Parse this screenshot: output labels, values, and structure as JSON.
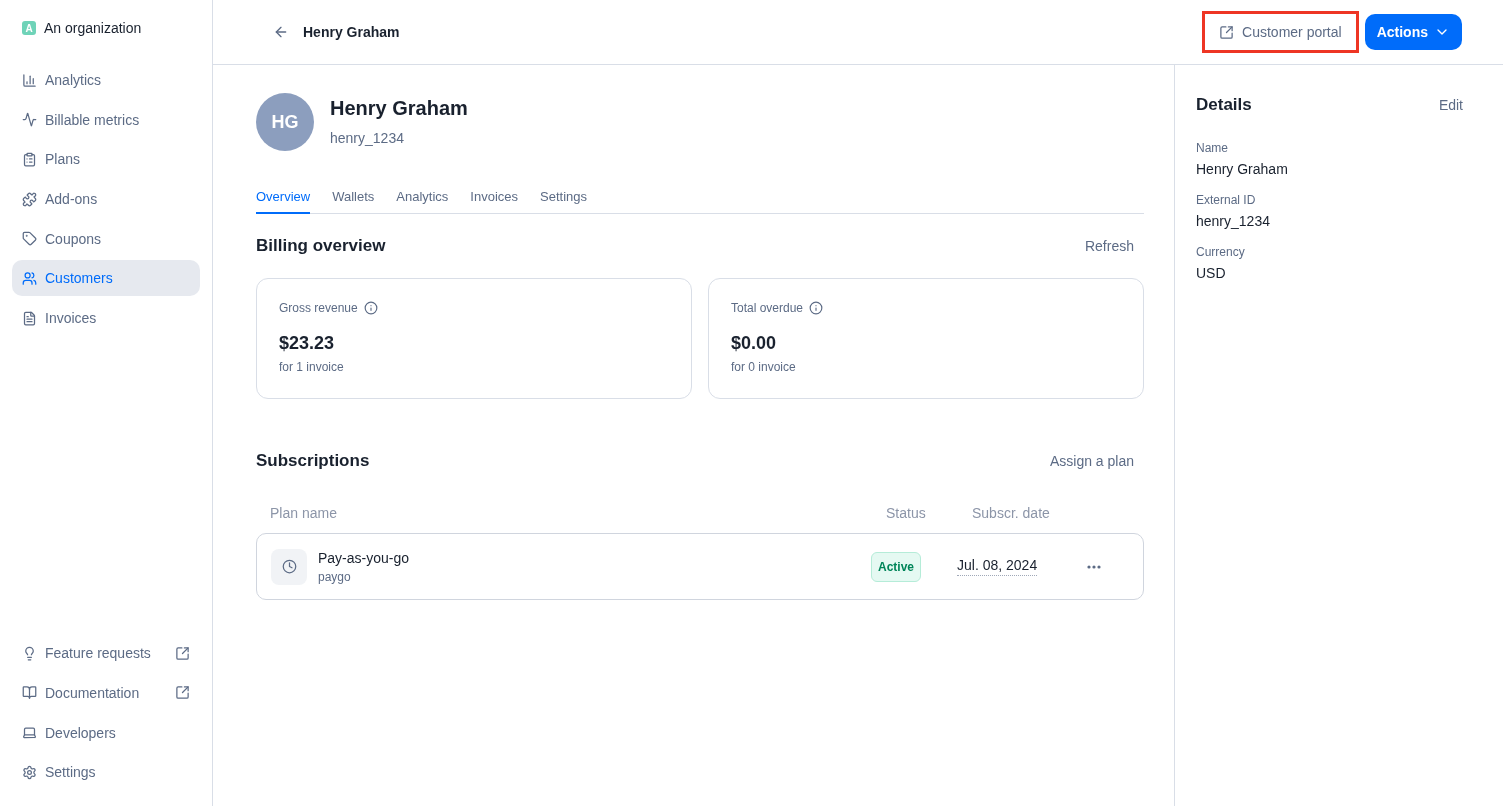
{
  "organization": {
    "initial": "A",
    "name": "An organization"
  },
  "sidebar": {
    "items": [
      {
        "label": "Analytics",
        "selected": false,
        "external": false
      },
      {
        "label": "Billable metrics",
        "selected": false,
        "external": false
      },
      {
        "label": "Plans",
        "selected": false,
        "external": false
      },
      {
        "label": "Add-ons",
        "selected": false,
        "external": false
      },
      {
        "label": "Coupons",
        "selected": false,
        "external": false
      },
      {
        "label": "Customers",
        "selected": true,
        "external": false
      },
      {
        "label": "Invoices",
        "selected": false,
        "external": false
      }
    ],
    "footer_items": [
      {
        "label": "Feature requests",
        "external": true
      },
      {
        "label": "Documentation",
        "external": true
      },
      {
        "label": "Developers",
        "external": false
      },
      {
        "label": "Settings",
        "external": false
      }
    ]
  },
  "header": {
    "title": "Henry Graham",
    "portal_button": {
      "label": "Customer portal",
      "highlighted": true
    },
    "actions_button": "Actions"
  },
  "customer": {
    "initials": "HG",
    "name": "Henry Graham",
    "external_id": "henry_1234"
  },
  "tabs": [
    {
      "label": "Overview",
      "selected": true
    },
    {
      "label": "Wallets",
      "selected": false
    },
    {
      "label": "Analytics",
      "selected": false
    },
    {
      "label": "Invoices",
      "selected": false
    },
    {
      "label": "Settings",
      "selected": false
    }
  ],
  "billing_overview": {
    "title": "Billing overview",
    "action": "Refresh",
    "cards": [
      {
        "label": "Gross revenue",
        "amount": "$23.23",
        "note": "for 1 invoice"
      },
      {
        "label": "Total overdue",
        "amount": "$0.00",
        "note": "for 0 invoice"
      }
    ]
  },
  "subscriptions": {
    "title": "Subscriptions",
    "action": "Assign a plan",
    "columns": [
      "Plan name",
      "Status",
      "Subscr. date"
    ],
    "rows": [
      {
        "name": "Pay-as-you-go",
        "code": "paygo",
        "status": "Active",
        "date": "Jul. 08, 2024"
      }
    ]
  },
  "details": {
    "title": "Details",
    "action": "Edit",
    "fields": [
      {
        "label": "Name",
        "value": "Henry Graham"
      },
      {
        "label": "External ID",
        "value": "henry_1234"
      },
      {
        "label": "Currency",
        "value": "USD"
      }
    ]
  }
}
